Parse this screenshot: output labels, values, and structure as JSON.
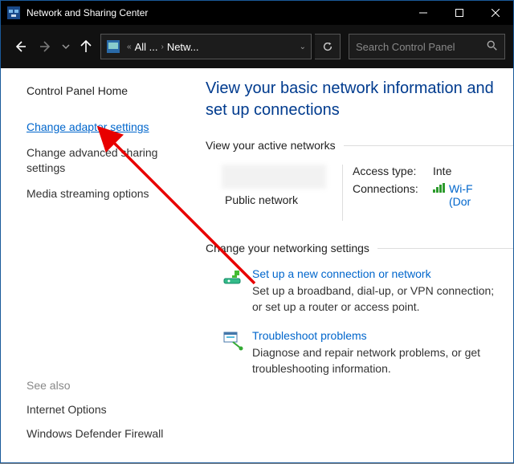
{
  "window": {
    "title": "Network and Sharing Center"
  },
  "breadcrumb": {
    "seg1": "All ...",
    "seg2": "Netw..."
  },
  "search": {
    "placeholder": "Search Control Panel"
  },
  "sidebar": {
    "home": "Control Panel Home",
    "tasks": {
      "change_adapter": "Change adapter settings",
      "change_advanced": "Change advanced sharing settings",
      "media_streaming": "Media streaming options"
    },
    "see_also_head": "See also",
    "see_also": {
      "internet_options": "Internet Options",
      "firewall": "Windows Defender Firewall"
    }
  },
  "main": {
    "heading": "View your basic network information and set up connections",
    "active_label": "View your active networks",
    "network": {
      "type": "Public network",
      "access_label": "Access type:",
      "access_value": "Inte",
      "connections_label": "Connections:",
      "connections_value": "Wi-F",
      "connections_sub": "(Dor"
    },
    "change_label": "Change your networking settings",
    "setup": {
      "title": "Set up a new connection or network",
      "desc": "Set up a broadband, dial-up, or VPN connection; or set up a router or access point."
    },
    "troubleshoot": {
      "title": "Troubleshoot problems",
      "desc": "Diagnose and repair network problems, or get troubleshooting information."
    }
  }
}
